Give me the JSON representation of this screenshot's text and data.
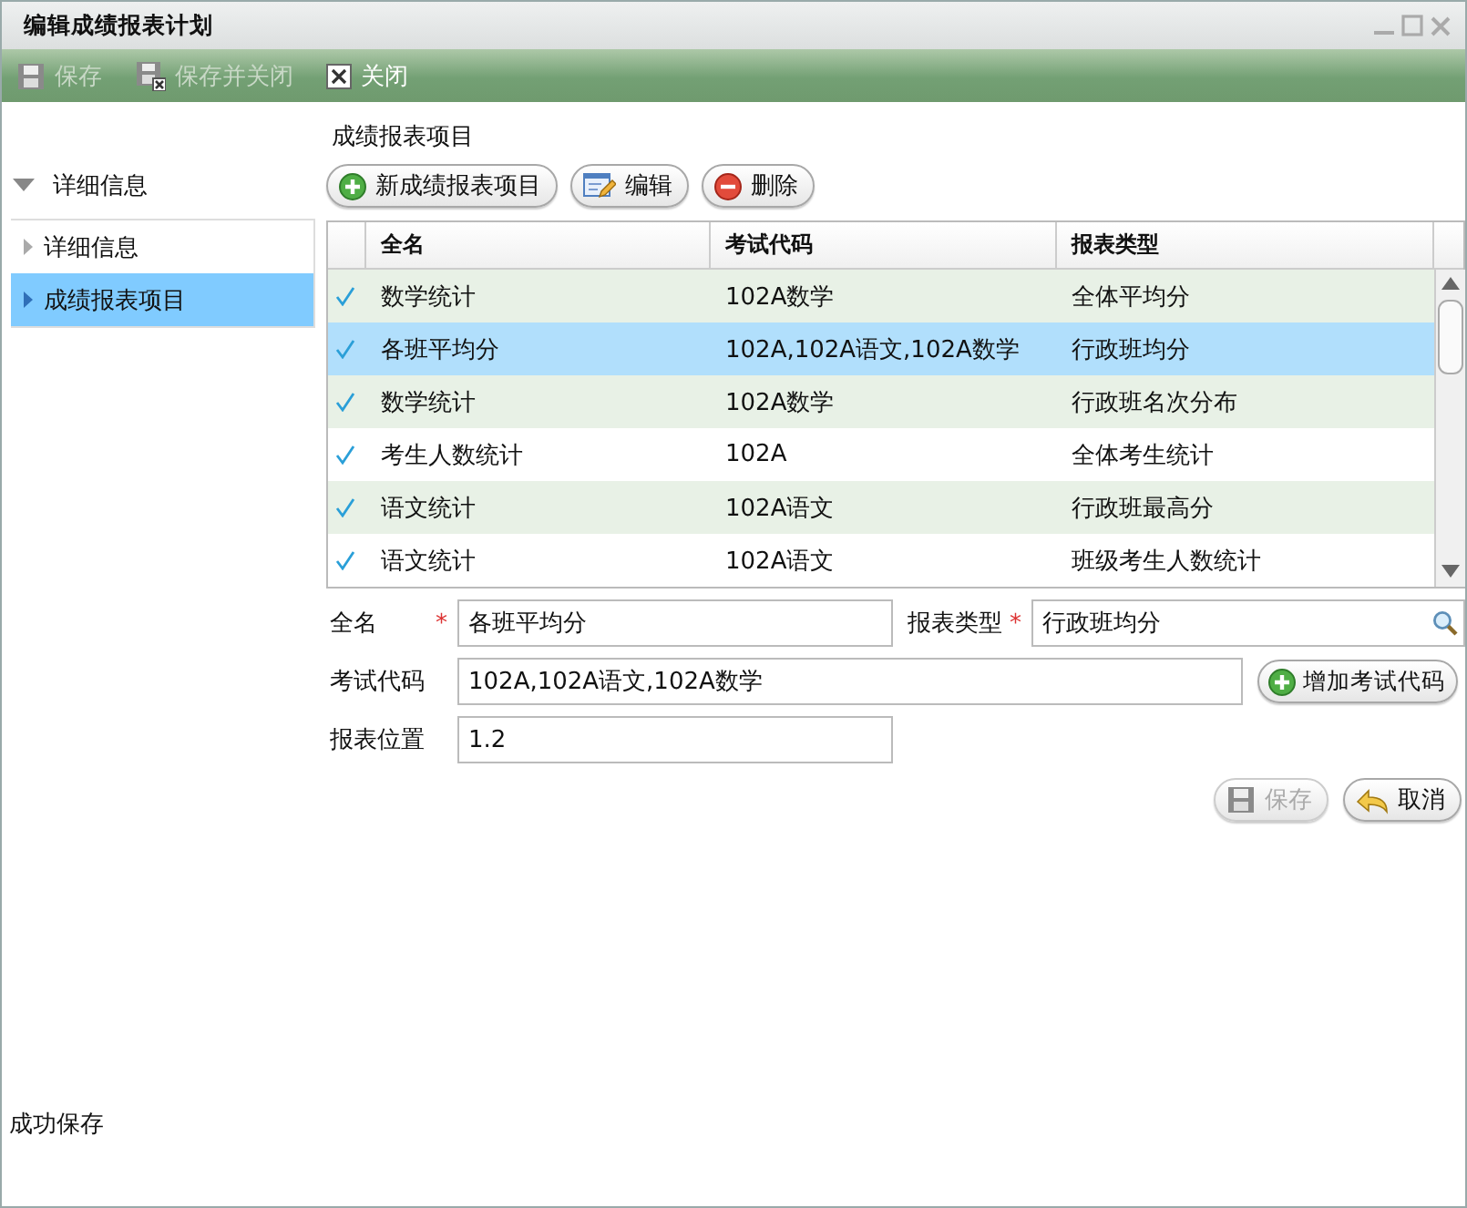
{
  "window": {
    "title": "编辑成绩报表计划"
  },
  "toolbar": [
    {
      "label": "保存",
      "disabled": true
    },
    {
      "label": "保存并关闭",
      "disabled": true
    },
    {
      "label": "关闭",
      "disabled": false
    }
  ],
  "sidebar": {
    "header": "详细信息",
    "expanded": true,
    "items": [
      {
        "label": "详细信息",
        "selected": false
      },
      {
        "label": "成绩报表项目",
        "selected": true
      }
    ]
  },
  "section_title": "成绩报表项目",
  "grid_buttons": [
    {
      "label": "新成绩报表项目"
    },
    {
      "label": "编辑"
    },
    {
      "label": "删除"
    }
  ],
  "table": {
    "columns": [
      "全名",
      "考试代码",
      "报表类型"
    ],
    "rows": [
      {
        "cells": [
          "数学统计",
          "102A数学",
          "全体平均分"
        ],
        "checked": true,
        "selected": false
      },
      {
        "cells": [
          "各班平均分",
          "102A,102A语文,102A数学",
          "行政班均分"
        ],
        "checked": true,
        "selected": true
      },
      {
        "cells": [
          "数学统计",
          "102A数学",
          "行政班名次分布"
        ],
        "checked": true,
        "selected": false
      },
      {
        "cells": [
          "考生人数统计",
          "102A",
          "全体考生统计"
        ],
        "checked": true,
        "selected": false
      },
      {
        "cells": [
          "语文统计",
          "102A语文",
          "行政班最高分"
        ],
        "checked": true,
        "selected": false
      },
      {
        "cells": [
          "语文统计",
          "102A语文",
          "班级考生人数统计"
        ],
        "checked": true,
        "selected": false
      }
    ]
  },
  "form": {
    "rows": [
      {
        "fields": [
          {
            "label": "全名",
            "required_mark": "*",
            "value": "各班平均分",
            "kind": "text"
          },
          {
            "label": "报表类型",
            "required_mark": "*",
            "value": "行政班均分",
            "kind": "lookup"
          }
        ]
      },
      {
        "fields": [
          {
            "label": "考试代码",
            "value": "102A,102A语文,102A数学",
            "kind": "wide"
          }
        ],
        "button": {
          "label": "增加考试代码"
        }
      },
      {
        "fields": [
          {
            "label": "报表位置",
            "value": "1.2",
            "kind": "text"
          }
        ]
      }
    ]
  },
  "actions": [
    {
      "label": "保存",
      "disabled": true
    },
    {
      "label": "取消",
      "disabled": false
    }
  ],
  "status": "成功保存"
}
